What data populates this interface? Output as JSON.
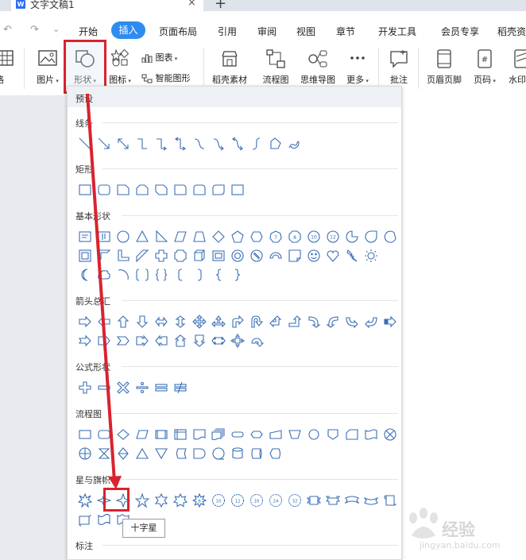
{
  "window": {
    "doc_icon": "W",
    "doc_title": "文字文稿1",
    "close_tab": "×",
    "new_tab": "+"
  },
  "menubar": {
    "quick_access": [
      "↶",
      "↷",
      "⌄"
    ],
    "items": [
      "开始",
      "插入",
      "页面布局",
      "引用",
      "审阅",
      "视图",
      "章节",
      "开发工具",
      "会员专享",
      "稻壳资"
    ],
    "active": "插入",
    "accent": "#2e8cf0"
  },
  "ribbon": {
    "table": "格",
    "picture": "图片",
    "shape": "形状",
    "icon": "图标",
    "chart": "图表",
    "smart_art": "智能图形",
    "docer_material": "稻壳素材",
    "flowchart": "流程图",
    "mindmap": "思维导图",
    "more": "更多",
    "comment": "批注",
    "header_footer": "页眉页脚",
    "page_number": "页码",
    "watermark": "水印"
  },
  "panel": {
    "title": "预设",
    "sections": {
      "lines": "线条",
      "rectangles": "矩形",
      "basic_shapes": "基本形状",
      "block_arrows": "箭头总汇",
      "equation_shapes": "公式形状",
      "flowchart": "流程图",
      "stars_banners": "星与旗帜",
      "callouts": "标注"
    },
    "tooltip": "十字星"
  },
  "highlight_color": "#d9232e",
  "shape_stroke": "#3b6fb6",
  "watermark": {
    "brand": "经验",
    "url": "jingyan.baidu.com"
  }
}
